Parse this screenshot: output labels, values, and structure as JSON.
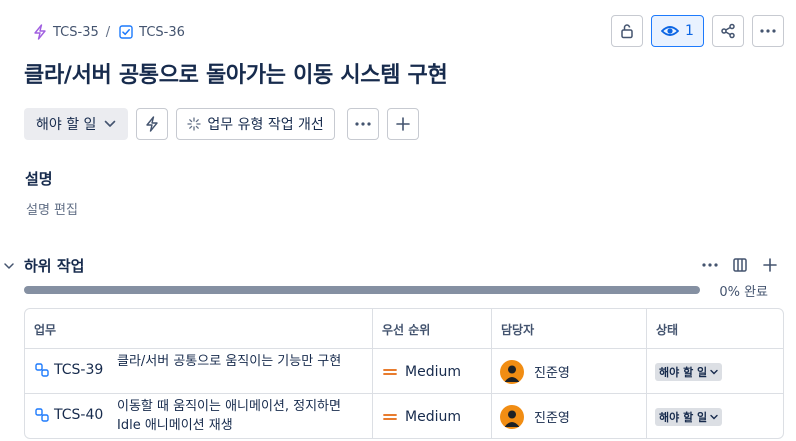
{
  "breadcrumb": {
    "items": [
      {
        "key": "TCS-35",
        "icon": "epic-lightning-icon",
        "color": "#a05fe0"
      },
      {
        "key": "TCS-36",
        "icon": "task-checkbox-icon",
        "color": "#1d7afc"
      }
    ],
    "separator": "/"
  },
  "header_actions": {
    "watch_count": "1"
  },
  "issue": {
    "title": "클라/서버 공통으로 돌아가는 이동 시스템 구현"
  },
  "toolbar": {
    "status_label": "해야 할 일",
    "improve_label": "업무 유형 작업 개선"
  },
  "description": {
    "heading": "설명",
    "placeholder": "설명 편집"
  },
  "subtasks": {
    "heading": "하위 작업",
    "progress_percent": 0,
    "progress_text": "0% 완료",
    "columns": [
      "업무",
      "우선 순위",
      "담당자",
      "상태"
    ],
    "rows": [
      {
        "key": "TCS-39",
        "summary": "클라/서버 공통으로 움직이는 기능만 구현",
        "priority": "Medium",
        "assignee": "진준영",
        "status": "해야 할 일"
      },
      {
        "key": "TCS-40",
        "summary": "이동할 때 움직이는 애니메이션, 정지하면 Idle 애니메이션 재생",
        "priority": "Medium",
        "assignee": "진준영",
        "status": "해야 할 일"
      }
    ]
  },
  "colors": {
    "accent": "#0c66e4",
    "priority_medium": "#e56910",
    "avatar_bg": "#f18d13",
    "epic": "#a05fe0",
    "subtask": "#1d7afc"
  }
}
